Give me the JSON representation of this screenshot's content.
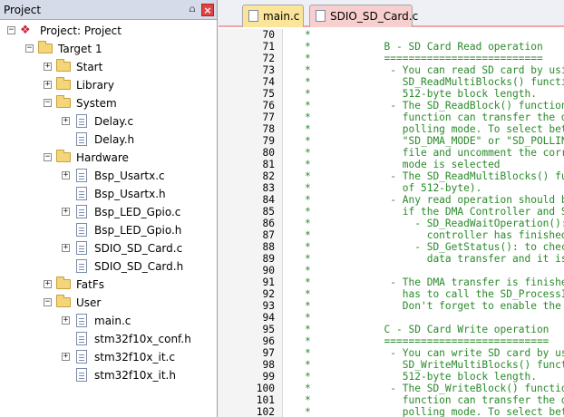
{
  "project_panel": {
    "title": "Project",
    "pin_glyph": "⩍",
    "close_glyph": "×"
  },
  "tree": [
    {
      "label": "Project: Project",
      "kind": "project",
      "depth": 0,
      "expander": "-"
    },
    {
      "label": "Target 1",
      "kind": "target",
      "depth": 1,
      "expander": "-"
    },
    {
      "label": "Start",
      "kind": "folder",
      "depth": 2,
      "expander": "+"
    },
    {
      "label": "Library",
      "kind": "folder",
      "depth": 2,
      "expander": "+"
    },
    {
      "label": "System",
      "kind": "folder",
      "depth": 2,
      "expander": "-"
    },
    {
      "label": "Delay.c",
      "kind": "file",
      "depth": 3,
      "expander": "+"
    },
    {
      "label": "Delay.h",
      "kind": "file",
      "depth": 3,
      "expander": ""
    },
    {
      "label": "Hardware",
      "kind": "folder",
      "depth": 2,
      "expander": "-"
    },
    {
      "label": "Bsp_Usartx.c",
      "kind": "file",
      "depth": 3,
      "expander": "+"
    },
    {
      "label": "Bsp_Usartx.h",
      "kind": "file",
      "depth": 3,
      "expander": ""
    },
    {
      "label": "Bsp_LED_Gpio.c",
      "kind": "file",
      "depth": 3,
      "expander": "+"
    },
    {
      "label": "Bsp_LED_Gpio.h",
      "kind": "file",
      "depth": 3,
      "expander": ""
    },
    {
      "label": "SDIO_SD_Card.c",
      "kind": "file",
      "depth": 3,
      "expander": "+"
    },
    {
      "label": "SDIO_SD_Card.h",
      "kind": "file",
      "depth": 3,
      "expander": ""
    },
    {
      "label": "FatFs",
      "kind": "folder",
      "depth": 2,
      "expander": "+"
    },
    {
      "label": "User",
      "kind": "folder",
      "depth": 2,
      "expander": "-"
    },
    {
      "label": "main.c",
      "kind": "file",
      "depth": 3,
      "expander": "+"
    },
    {
      "label": "stm32f10x_conf.h",
      "kind": "file",
      "depth": 3,
      "expander": ""
    },
    {
      "label": "stm32f10x_it.c",
      "kind": "file",
      "depth": 3,
      "expander": "+"
    },
    {
      "label": "stm32f10x_it.h",
      "kind": "file",
      "depth": 3,
      "expander": ""
    }
  ],
  "tabs": [
    {
      "label": "main.c",
      "active": false,
      "color": "#fbe59a"
    },
    {
      "label": "SDIO_SD_Card.c",
      "active": true,
      "color": "#f8cfcf"
    }
  ],
  "colors": {
    "comment": "#2a8a2a",
    "line_number": "#000000",
    "active_tab_border": "#f3a5a5"
  },
  "code": [
    {
      "num": "70",
      "text": "*"
    },
    {
      "num": "71",
      "text": "*            B - SD Card Read operation"
    },
    {
      "num": "72",
      "text": "*            =========================="
    },
    {
      "num": "73",
      "text": "*             - You can read SD card by usi"
    },
    {
      "num": "74",
      "text": "*               SD_ReadMultiBlocks() functi"
    },
    {
      "num": "75",
      "text": "*               512-byte block length."
    },
    {
      "num": "76",
      "text": "*             - The SD_ReadBlock() function"
    },
    {
      "num": "77",
      "text": "*               function can transfer the d"
    },
    {
      "num": "78",
      "text": "*               polling mode. To select bet"
    },
    {
      "num": "79",
      "text": "*               \"SD_DMA_MODE\" or \"SD_POLLIN"
    },
    {
      "num": "80",
      "text": "*               file and uncomment the corr"
    },
    {
      "num": "81",
      "text": "*               mode is selected"
    },
    {
      "num": "82",
      "text": "*             - The SD_ReadMultiBlocks() fu"
    },
    {
      "num": "83",
      "text": "*               of 512-byte)."
    },
    {
      "num": "84",
      "text": "*             - Any read operation should b"
    },
    {
      "num": "85",
      "text": "*               if the DMA Controller and S"
    },
    {
      "num": "86",
      "text": "*                 - SD_ReadWaitOperation(): "
    },
    {
      "num": "87",
      "text": "*                   controller has finished"
    },
    {
      "num": "88",
      "text": "*                 - SD_GetStatus(): to check"
    },
    {
      "num": "89",
      "text": "*                   data transfer and it is"
    },
    {
      "num": "90",
      "text": "*"
    },
    {
      "num": "91",
      "text": "*             - The DMA transfer is finishe"
    },
    {
      "num": "92",
      "text": "*               has to call the SD_ProcessI"
    },
    {
      "num": "93",
      "text": "*               Don't forget to enable the"
    },
    {
      "num": "94",
      "text": "*"
    },
    {
      "num": "95",
      "text": "*            C - SD Card Write operation"
    },
    {
      "num": "96",
      "text": "*            ==========================="
    },
    {
      "num": "97",
      "text": "*             - You can write SD card by us"
    },
    {
      "num": "98",
      "text": "*               SD_WriteMultiBlocks() funct"
    },
    {
      "num": "99",
      "text": "*               512-byte block length."
    },
    {
      "num": "100",
      "text": "*             - The SD_WriteBlock() functio"
    },
    {
      "num": "101",
      "text": "*               function can transfer the d"
    },
    {
      "num": "102",
      "text": "*               polling mode. To select bet"
    }
  ]
}
